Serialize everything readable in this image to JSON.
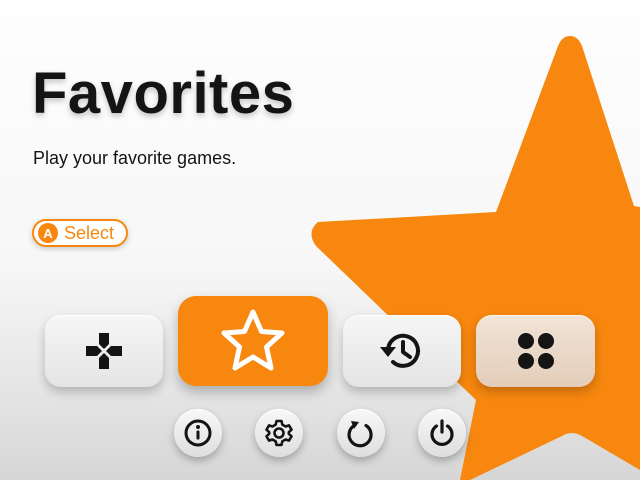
{
  "header": {
    "title": "Favorites",
    "subtitle": "Play your favorite games."
  },
  "hint": {
    "button_glyph": "A",
    "label": "Select"
  },
  "tiles": [
    {
      "id": "games",
      "icon": "gamepad-icon",
      "selected": false
    },
    {
      "id": "favorites",
      "icon": "star-icon",
      "selected": true
    },
    {
      "id": "history",
      "icon": "history-icon",
      "selected": false
    },
    {
      "id": "collections",
      "icon": "grid-icon",
      "selected": false
    }
  ],
  "system_buttons": [
    {
      "id": "info",
      "icon": "info-icon"
    },
    {
      "id": "settings",
      "icon": "gear-icon"
    },
    {
      "id": "restart",
      "icon": "restart-icon"
    },
    {
      "id": "power",
      "icon": "power-icon"
    }
  ],
  "colors": {
    "accent": "#f7870e",
    "text": "#141414",
    "tile": "#ececec",
    "tile_tinted": "#e8d5c4"
  }
}
